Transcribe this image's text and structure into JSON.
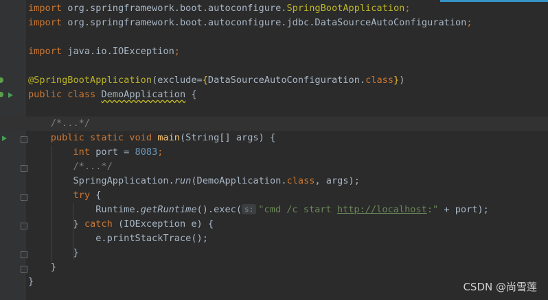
{
  "code": {
    "import1_kw": "import",
    "import1_pkg": " org.springframework.boot.autoconfigure.",
    "import1_cls": "SpringBootApplication",
    "import1_end": ";",
    "import2_kw": "import",
    "import2_pkg": " org.springframework.boot.autoconfigure.jdbc.DataSourceAutoConfiguration",
    "import2_end": ";",
    "import3_kw": "import",
    "import3_pkg": " java.io.IOException",
    "import3_end": ";",
    "ann_name": "@SpringBootApplication",
    "ann_open": "(exclude=",
    "ann_brace_open": "{",
    "ann_cls": "DataSourceAutoConfiguration.",
    "ann_class_kw": "class",
    "ann_brace_close": "}",
    "ann_close": ")",
    "class_kw": "public class ",
    "class_name": "DemoApplication",
    "class_open": " {",
    "fold_comment1": "/*...*/",
    "main_kw": "public static void ",
    "main_name": "main",
    "main_params": "(String[] args) {",
    "port_kw": "int",
    "port_decl": " port = ",
    "port_val": "8083",
    "port_end": ";",
    "fold_comment2": "/*...*/",
    "run_cls": "SpringApplication.",
    "run_method": "run",
    "run_args": "(DemoApplication.",
    "run_class_kw": "class",
    "run_end": ", args);",
    "try_kw": "try",
    "try_open": " {",
    "exec_cls": "Runtime.",
    "exec_method": "getRuntime",
    "exec_call": "().exec(",
    "exec_hint": "s:",
    "exec_str_start": "\"cmd /c start ",
    "exec_link": "http://localhost",
    "exec_str_end": ":\"",
    "exec_end": " + port);",
    "catch_close": "} ",
    "catch_kw": "catch",
    "catch_args": " (IOException e) {",
    "print_call": "e.printStackTrace",
    "print_end": "();",
    "close_inner": "}",
    "close_main": "}",
    "close_class": "}"
  },
  "watermark": "CSDN @尚雪莲"
}
